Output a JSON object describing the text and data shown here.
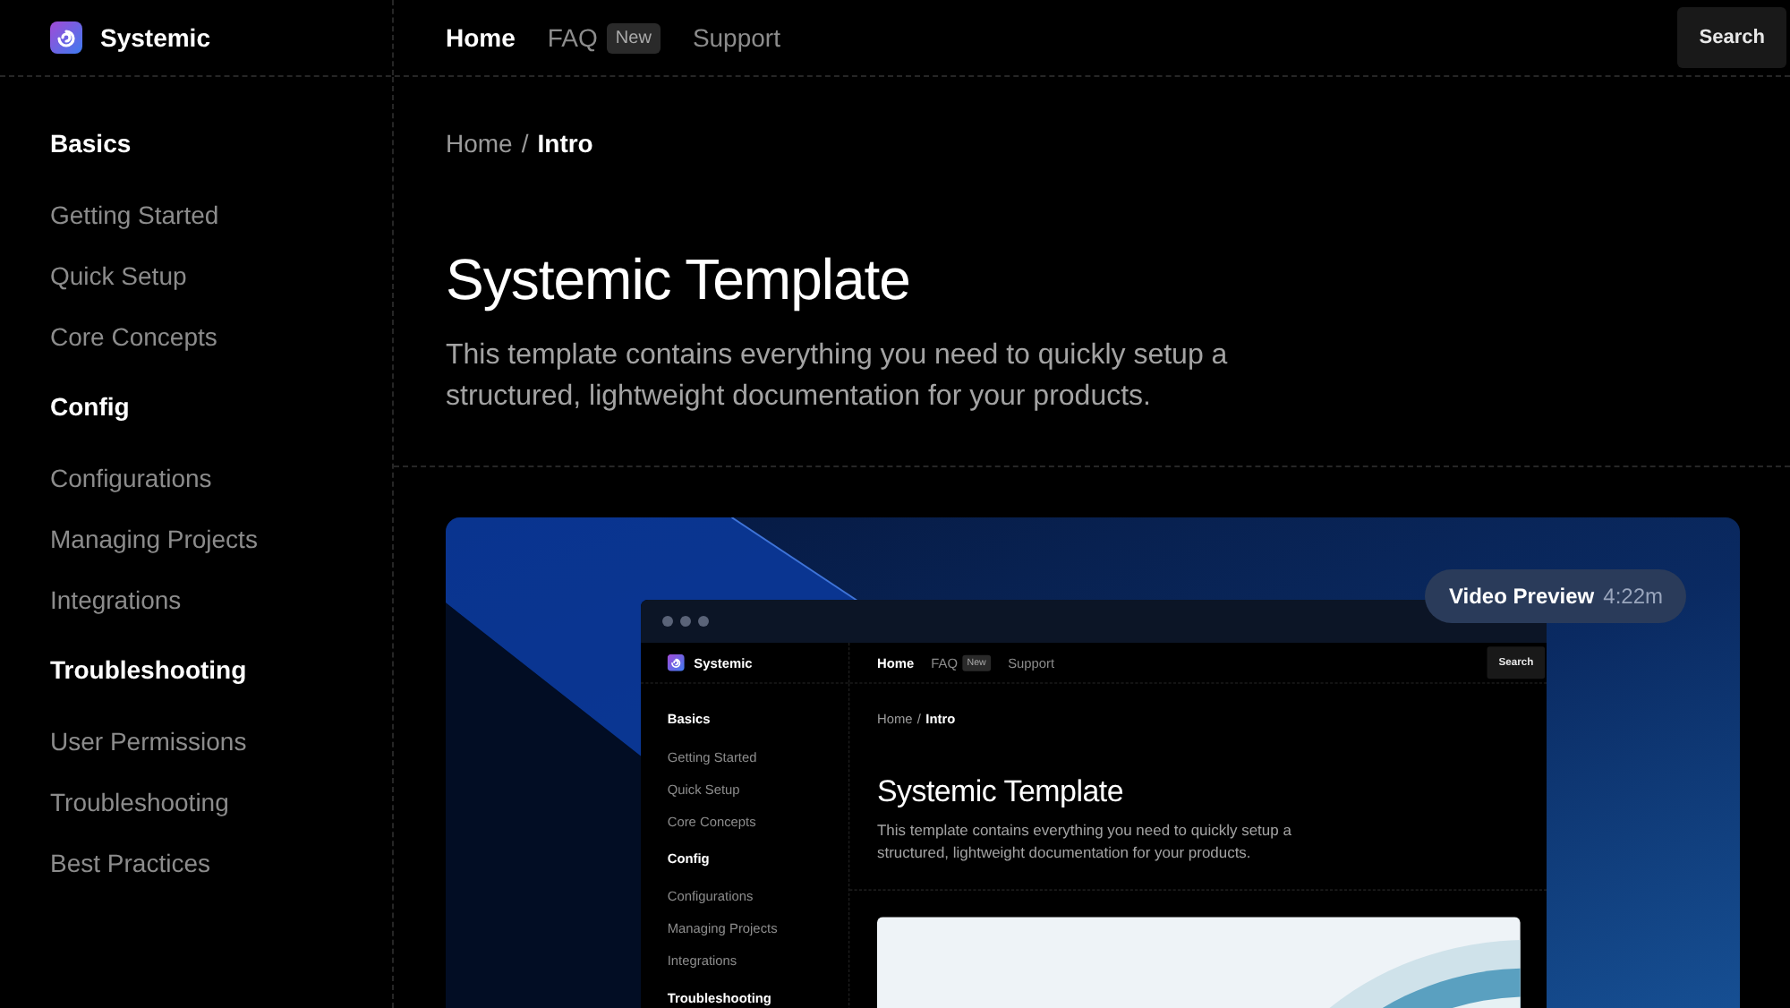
{
  "header": {
    "brand": "Systemic",
    "nav": [
      {
        "label": "Home",
        "selected": true
      },
      {
        "label": "FAQ",
        "selected": false,
        "badge": "New"
      },
      {
        "label": "Support",
        "selected": false
      }
    ],
    "search": "Search"
  },
  "sidebar": {
    "sections": [
      {
        "title": "Basics",
        "items": [
          "Getting Started",
          "Quick Setup",
          "Core Concepts"
        ]
      },
      {
        "title": "Config",
        "items": [
          "Configurations",
          "Managing Projects",
          "Integrations"
        ]
      },
      {
        "title": "Troubleshooting",
        "items": [
          "User Permissions",
          "Troubleshooting",
          "Best Practices"
        ]
      }
    ]
  },
  "breadcrumb": {
    "items": [
      "Home",
      "Intro"
    ],
    "separator": "/"
  },
  "title": "Systemic Template",
  "description": "This template contains everything you need to quickly setup a structured, lightweight documentation for your products.",
  "video": {
    "label": "Video Preview",
    "duration": "4:22m",
    "screenshot": {
      "header": {
        "brand": "Systemic",
        "nav": [
          {
            "label": "Home",
            "selected": true
          },
          {
            "label": "FAQ",
            "selected": false,
            "badge": "New"
          },
          {
            "label": "Support",
            "selected": false
          }
        ],
        "search": "Search"
      },
      "sidebar": {
        "sections": [
          {
            "title": "Basics",
            "items": [
              "Getting Started",
              "Quick Setup",
              "Core Concepts"
            ]
          },
          {
            "title": "Config",
            "items": [
              "Configurations",
              "Managing Projects",
              "Integrations"
            ]
          },
          {
            "title": "Troubleshooting"
          }
        ]
      },
      "breadcrumb": {
        "items": [
          "Home",
          "Intro"
        ],
        "separator": "/"
      },
      "title": "Systemic Template",
      "description": "This template contains everything you need to quickly setup a structured, lightweight documentation for your products."
    }
  }
}
